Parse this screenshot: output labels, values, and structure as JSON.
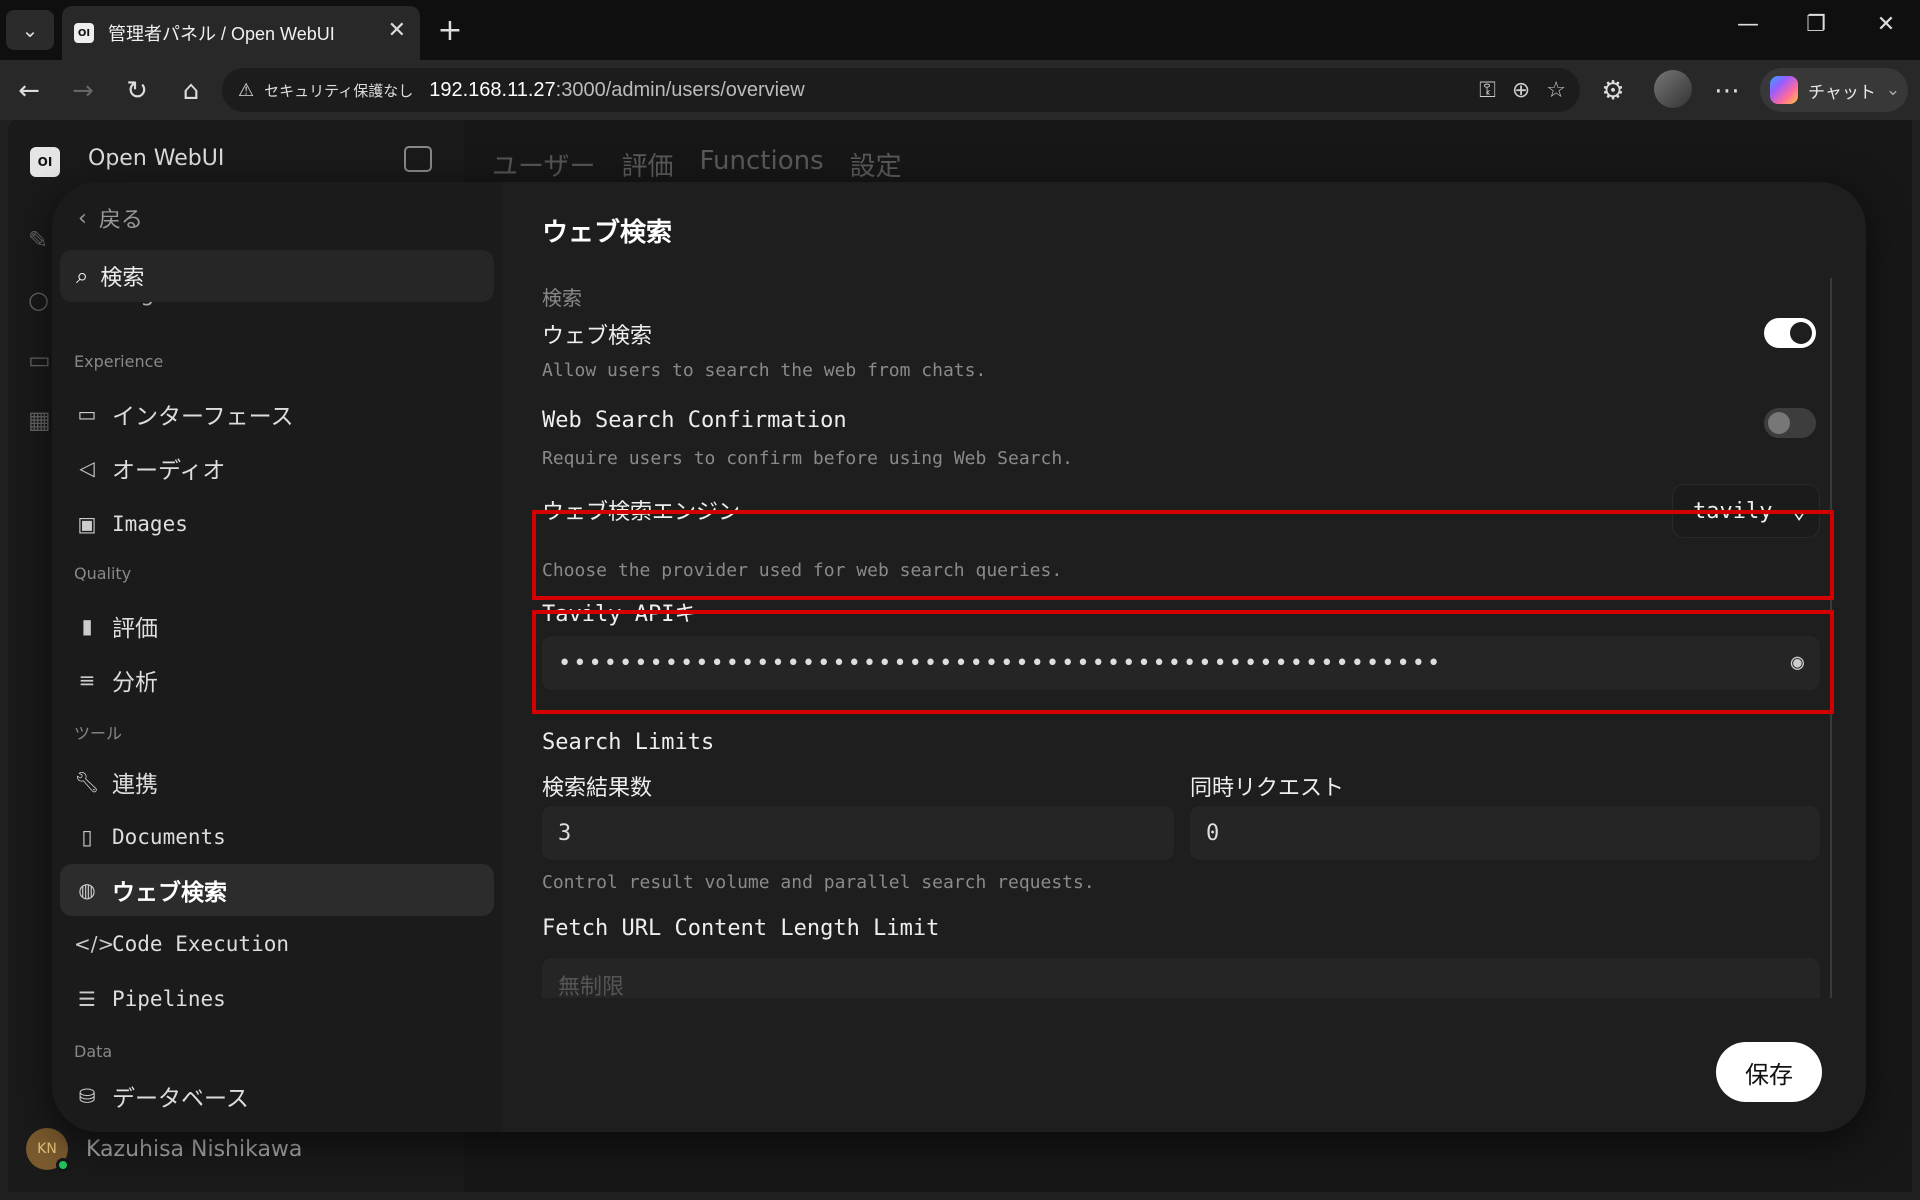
{
  "browser": {
    "tab_title": "管理者パネル / Open WebUI",
    "favicon_text": "OI",
    "security_label": "セキュリティ保護なし",
    "url_host": "192.168.11.27",
    "url_path": ":3000/admin/users/overview",
    "chat_label": "チャット"
  },
  "app": {
    "logo_text": "OI",
    "name": "Open WebUI",
    "tabs": [
      "ユーザー",
      "評価",
      "Functions",
      "設定"
    ],
    "user_initials": "KN",
    "user_name": "Kazuhisa Nishikawa"
  },
  "settings_nav": {
    "back_label": "戻る",
    "search_placeholder": "検索",
    "cut_item": "Sub agents",
    "sections": {
      "experience": "Experience",
      "quality": "Quality",
      "tools": "ツール",
      "data": "Data"
    },
    "items": {
      "interface": "インターフェース",
      "audio": "オーディオ",
      "images": "Images",
      "evaluations": "評価",
      "analytics": "分析",
      "integrations": "連携",
      "documents": "Documents",
      "web_search": "ウェブ検索",
      "code_execution": "Code Execution",
      "pipelines": "Pipelines",
      "database": "データベース"
    }
  },
  "web_search": {
    "title": "ウェブ検索",
    "subsection": "検索",
    "enable_label": "ウェブ検索",
    "enable_desc": "Allow users to search the web from chats.",
    "enable_on": true,
    "confirm_label": "Web Search Confirmation",
    "confirm_desc": "Require users to confirm before using Web Search.",
    "confirm_on": false,
    "engine_label": "ウェブ検索エンジン",
    "engine_value": "tavily",
    "engine_desc": "Choose the provider used for web search queries.",
    "api_key_label": "Tavily APIキー",
    "api_key_value": "••••••••••••••••••••••••••••••••••••••••••••••••••••••••••",
    "limits_heading": "Search Limits",
    "result_count_label": "検索結果数",
    "result_count_value": "3",
    "concurrent_label": "同時リクエスト",
    "concurrent_value": "0",
    "limits_desc": "Control result volume and parallel search requests.",
    "fetch_label": "Fetch URL Content Length Limit",
    "fetch_placeholder": "無制限"
  },
  "save_label": "保存",
  "colors": {
    "highlight": "#d40000",
    "accent_toggle": "#ffffff"
  }
}
